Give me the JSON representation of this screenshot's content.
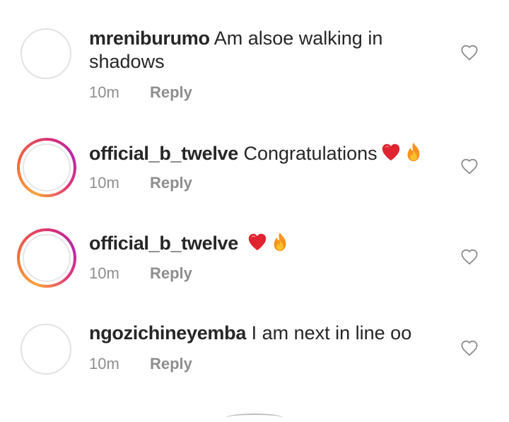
{
  "comments": [
    {
      "username": "mreniburumo",
      "text": "Am alsoe walking in shadows",
      "time": "10m",
      "reply_label": "Reply",
      "avatar_style": "plain",
      "emojis": []
    },
    {
      "username": "official_b_twelve",
      "text": "Congratulations",
      "time": "10m",
      "reply_label": "Reply",
      "avatar_style": "story-ring",
      "emojis": [
        "heart-emoji",
        "fire-emoji"
      ]
    },
    {
      "username": "official_b_twelve",
      "text": "",
      "time": "10m",
      "reply_label": "Reply",
      "avatar_style": "story-ring",
      "emojis": [
        "heart-emoji",
        "fire-emoji"
      ]
    },
    {
      "username": "ngozichineyemba",
      "text": "I am next in line oo",
      "time": "10m",
      "reply_label": "Reply",
      "avatar_style": "plain",
      "emojis": []
    }
  ],
  "colors": {
    "text": "#262626",
    "muted": "#8e8e8e",
    "heart_emoji": "#e0242f",
    "fire_outer": "#f7931e",
    "fire_inner": "#fbc02d",
    "story_ring_start": "#f9a23a",
    "story_ring_end": "#b728a6"
  },
  "icons": {
    "like": "heart-outline-icon"
  }
}
